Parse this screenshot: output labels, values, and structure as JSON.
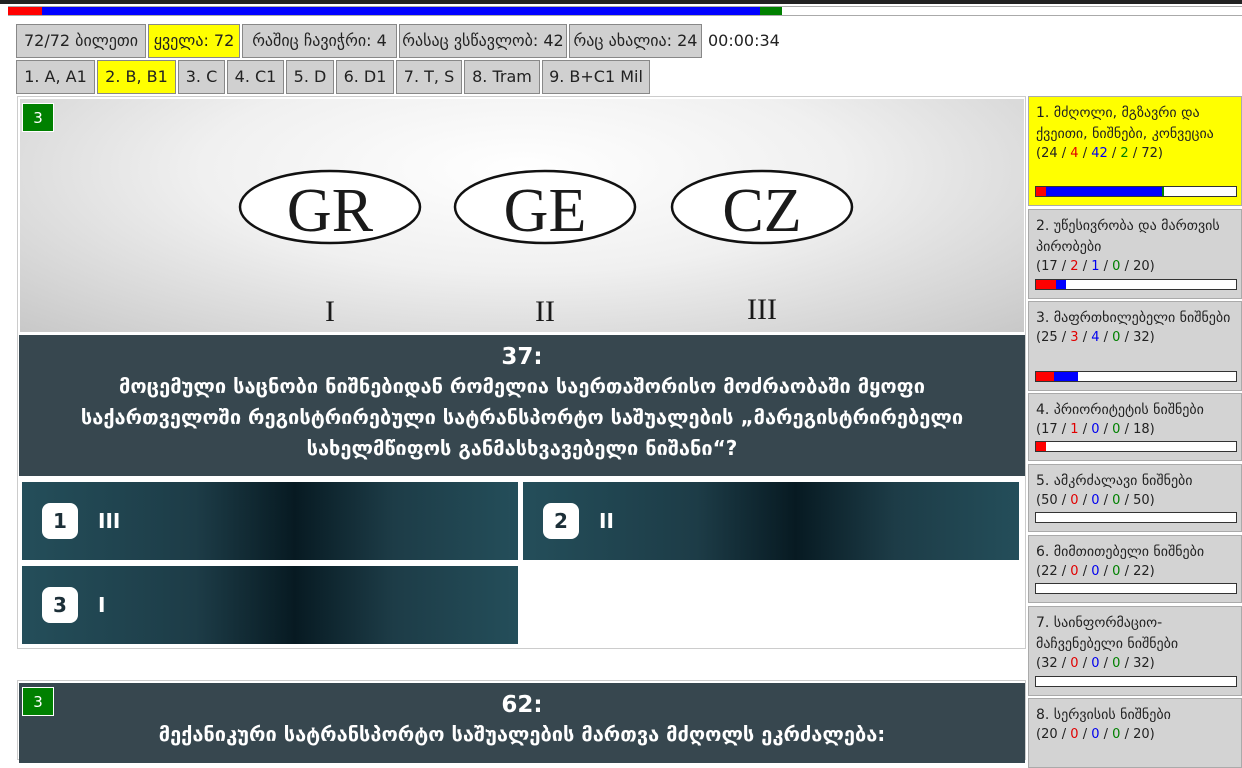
{
  "colors": {
    "red": "#ff0000",
    "blue": "#0000ff",
    "green": "#008000",
    "selected": "#ffff00",
    "question_bg": "#37474f"
  },
  "progress": {
    "wrong": 72,
    "correct": 0,
    "learning": 0,
    "new": 0,
    "segments": [
      {
        "color": "#ff0000",
        "fraction": 0.05
      },
      {
        "color": "#0000ff",
        "fraction": 0.582
      },
      {
        "color": "#008000",
        "fraction": 0.018
      }
    ]
  },
  "header": {
    "tickets": "72/72 ბილეთი",
    "all": "ყველა: 72",
    "wrong": "რაშიც ჩავიჭრი: 4",
    "learning": "რასაც ვსწავლობ: 42",
    "new": "რაც ახალია: 24",
    "timer": "00:00:34"
  },
  "license_tabs": [
    "1. A, A1",
    "2. B, B1",
    "3. C",
    "4. C1",
    "5. D",
    "6. D1",
    "7. T, S",
    "8. Tram",
    "9. B+C1 Mil"
  ],
  "selected_tab_index": 1,
  "question": {
    "category_badge": "3",
    "image_plates": [
      "GR",
      "GE",
      "CZ"
    ],
    "image_labels": [
      "I",
      "II",
      "III"
    ],
    "number": "37:",
    "text": "მოცემული საცნობი ნიშნებიდან რომელია საერთაშორისო მოძრაობაში მყოფი საქართველოში რეგისტრირებული სატრანსპორტო საშუალების „მარეგისტრირებელი სახელმწიფოს განმასხვავებელი ნიშანი“?",
    "answers": [
      {
        "num": "1",
        "text": "III"
      },
      {
        "num": "2",
        "text": "II"
      },
      {
        "num": "3",
        "text": "I"
      }
    ]
  },
  "question2": {
    "category_badge": "3",
    "number": "62:",
    "text": "მექანიკური სატრანსპორტო საშუალების მართვა მძღოლს ეკრძალება:"
  },
  "categories": [
    {
      "title": "1. მძღოლი, მგზავრი და ქვეითი, ნიშნები, კონვეცია",
      "a": "24",
      "b": "4",
      "c": "42",
      "d": "2",
      "e": "72",
      "bar": {
        "red": 0.05,
        "blue": 0.58,
        "green": 0.01
      }
    },
    {
      "title": "2. უწესივრობა და მართვის პირობები",
      "a": "17",
      "b": "2",
      "c": "1",
      "d": "0",
      "e": "20",
      "bar": {
        "red": 0.1,
        "blue": 0.05,
        "green": 0
      }
    },
    {
      "title": "3. მაფრთხილებელი ნიშნები",
      "a": "25",
      "b": "3",
      "c": "4",
      "d": "0",
      "e": "32",
      "bar": {
        "red": 0.09,
        "blue": 0.12,
        "green": 0
      }
    },
    {
      "title": "4. პრიორიტეტის ნიშნები",
      "a": "17",
      "b": "1",
      "c": "0",
      "d": "0",
      "e": "18",
      "bar": {
        "red": 0.05,
        "blue": 0,
        "green": 0
      }
    },
    {
      "title": "5. ამკრძალავი ნიშნები",
      "a": "50",
      "b": "0",
      "c": "0",
      "d": "0",
      "e": "50",
      "bar": {
        "red": 0,
        "blue": 0,
        "green": 0
      }
    },
    {
      "title": "6. მიმთითებელი ნიშნები",
      "a": "22",
      "b": "0",
      "c": "0",
      "d": "0",
      "e": "22",
      "bar": {
        "red": 0,
        "blue": 0,
        "green": 0
      }
    },
    {
      "title": "7. საინფორმაციო-მაჩვენებელი ნიშნები",
      "a": "32",
      "b": "0",
      "c": "0",
      "d": "0",
      "e": "32",
      "bar": {
        "red": 0,
        "blue": 0,
        "green": 0
      }
    },
    {
      "title": "8. სერვისის ნიშნები",
      "a": "20",
      "b": "0",
      "c": "0",
      "d": "0",
      "e": "20",
      "bar": {
        "red": 0,
        "blue": 0,
        "green": 0
      }
    }
  ]
}
